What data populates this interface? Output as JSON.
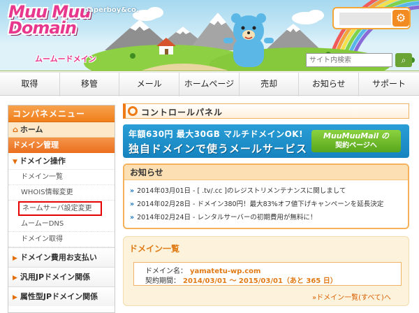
{
  "header": {
    "logo_title": "Muu Muu Domain",
    "logo_kana": "ムームードメイン",
    "paperboy": "paperboy&co.",
    "search_placeholder": "サイト内検索"
  },
  "nav": {
    "items": [
      "取得",
      "移管",
      "メール",
      "ホームページ",
      "売却",
      "お知らせ",
      "サポート"
    ]
  },
  "sidebar": {
    "title": "コンパネメニュー",
    "home": "ホーム",
    "domain_mgmt": "ドメイン管理",
    "domain_ops": "ドメイン操作",
    "links": [
      "ドメイン一覧",
      "WHOIS情報変更",
      "ネームサーバ設定変更",
      "ムームーDNS",
      "ドメイン取得"
    ],
    "sections": [
      "ドメイン費用お支払い",
      "汎用JPドメイン関係",
      "属性型JPドメイン関係"
    ]
  },
  "main": {
    "panel_title": "コントロールパネル",
    "banner": {
      "line1": "年額630円 最大30GB マルチドメインOK!",
      "line2": "独自ドメインで使うメールサービス",
      "cta_brand": "MuuMuuMail の",
      "cta_text": "契約ページへ"
    },
    "news": {
      "title": "お知らせ",
      "items": [
        "2014年03月01日 - [ .tv/.cc ]のレジストリメンテナンスに関しまして",
        "2014年02月28日 - ドメイン380円！最大83%オフ値下げキャンペーンを延長決定",
        "2014年02月24日 - レンタルサーバーの初期費用が無料に！"
      ]
    },
    "domain_list": {
      "title": "ドメイン一覧",
      "domain_label": "ドメイン名：",
      "domain_value": "yamatetu-wp.com",
      "period_label": "契約期間：",
      "period_value": "2014/03/01 〜 2015/03/01（あと 365 日）",
      "more": "»ドメイン一覧(すべて)へ"
    }
  },
  "colors": {
    "accent_orange": "#ee7b16",
    "banner_blue": "#1683bf",
    "highlight_red": "#e60000"
  }
}
